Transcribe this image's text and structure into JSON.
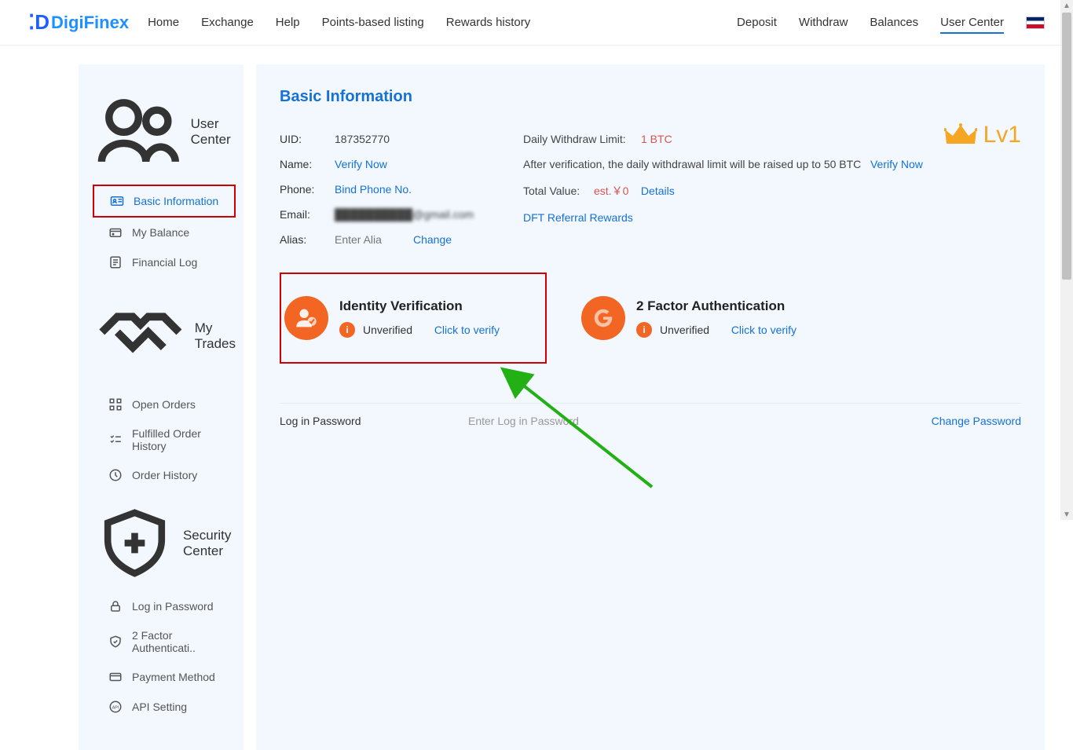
{
  "header": {
    "brand": "DigiFinex",
    "nav": [
      "Home",
      "Exchange",
      "Help",
      "Points-based listing",
      "Rewards history"
    ],
    "right": [
      "Deposit",
      "Withdraw",
      "Balances",
      "User Center"
    ]
  },
  "sidebar": {
    "user_center": {
      "title": "User Center",
      "items": [
        "Basic Information",
        "My Balance",
        "Financial Log"
      ]
    },
    "my_trades": {
      "title": "My Trades",
      "items": [
        "Open Orders",
        "Fulfilled Order History",
        "Order History"
      ]
    },
    "security_center": {
      "title": "Security Center",
      "items": [
        "Log in Password",
        "2 Factor Authenticati..",
        "Payment Method",
        "API Setting"
      ]
    }
  },
  "page": {
    "title": "Basic Information",
    "uid_label": "UID:",
    "uid": "187352770",
    "name_label": "Name:",
    "name_action": "Verify Now",
    "phone_label": "Phone:",
    "phone_action": "Bind Phone No.",
    "email_label": "Email:",
    "email_masked": "██████████@gmail.com",
    "alias_label": "Alias:",
    "alias_placeholder": "Enter Alia",
    "alias_action": "Change",
    "limit_label": "Daily Withdraw Limit:",
    "limit_value": "1 BTC",
    "limit_note": "After verification, the daily withdrawal limit will be raised up to 50 BTC",
    "limit_action": "Verify Now",
    "total_label": "Total Value:",
    "total_value": "est.￥0",
    "total_action": "Details",
    "referral": "DFT Referral Rewards",
    "level": "Lv1"
  },
  "cards": {
    "identity": {
      "title": "Identity Verification",
      "status": "Unverified",
      "action": "Click to verify"
    },
    "twofa": {
      "title": "2 Factor Authentication",
      "status": "Unverified",
      "action": "Click to verify"
    }
  },
  "password_row": {
    "label": "Log in Password",
    "placeholder": "Enter Log in Password",
    "action": "Change Password"
  }
}
